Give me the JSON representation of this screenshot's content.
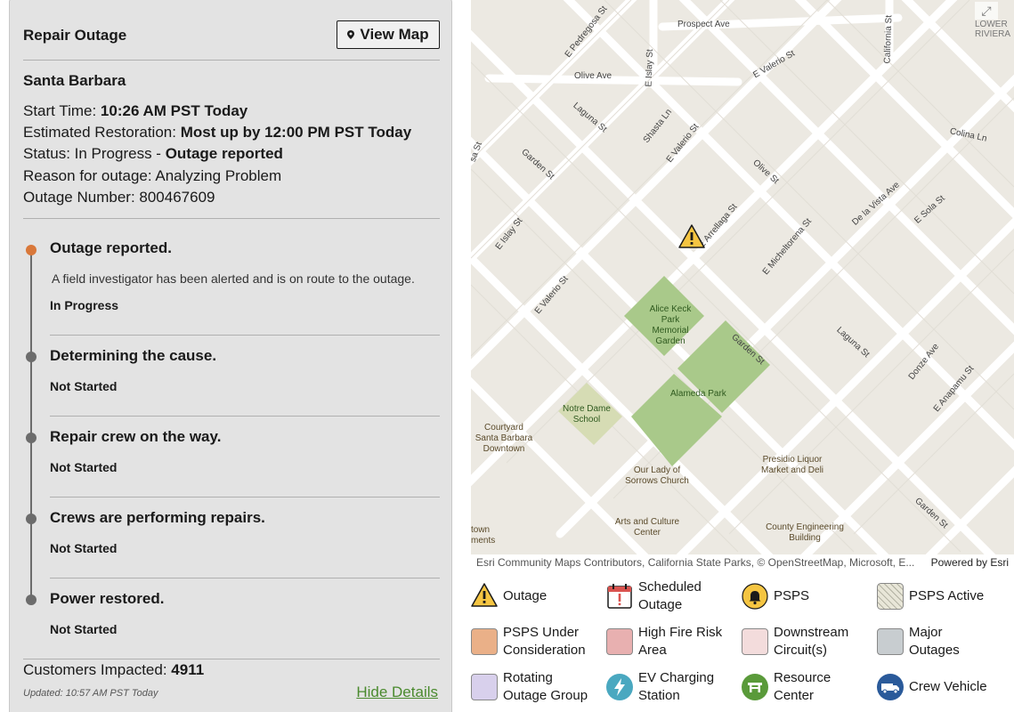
{
  "panel": {
    "title": "Repair Outage",
    "view_map_label": "View Map",
    "city": "Santa Barbara",
    "start_time_label": "Start Time: ",
    "start_time_value": "10:26 AM PST Today",
    "restoration_label": "Estimated Restoration: ",
    "restoration_value": "Most up by 12:00 PM PST Today",
    "status_label": "Status: In Progress - ",
    "status_value": "Outage reported",
    "reason": "Reason for outage: Analyzing Problem",
    "outage_number": "Outage Number: 800467609",
    "steps": [
      {
        "title": "Outage reported.",
        "desc": "A field investigator has been alerted and is on route to the outage.",
        "status": "In Progress"
      },
      {
        "title": "Determining the cause.",
        "status": "Not Started"
      },
      {
        "title": "Repair crew on the way.",
        "status": "Not Started"
      },
      {
        "title": "Crews are performing repairs.",
        "status": "Not Started"
      },
      {
        "title": "Power restored.",
        "status": "Not Started"
      }
    ],
    "customers_label": "Customers Impacted: ",
    "customers_value": "4911",
    "updated": "Updated: 10:57 AM PST Today",
    "hide_details": "Hide Details"
  },
  "map": {
    "streets": [
      "E Pedregosa St",
      "Prospect Ave",
      "California St",
      "E Islay St",
      "Olive Ave",
      "E Valerio St",
      "Laguna St",
      "Shasta Ln",
      "E Valerio St",
      "Colina Ln",
      "Garden St",
      "Olive St",
      "De la Vista Ave",
      "E Sola St",
      "sa St",
      "E Islay St",
      "E Arrellaga St",
      "E Micheltorena St",
      "E Valerio St",
      "Garden St",
      "Laguna St",
      "Donze Ave",
      "E Anapamu St",
      "Garden St"
    ],
    "area_label": "LOWER RIVIERA",
    "parks": [
      "Alice Keck Park Memorial Garden",
      "Alameda Park",
      "Notre Dame School"
    ],
    "pois": [
      "Courtyard Santa Barbara Downtown",
      "Our Lady of Sorrows Church",
      "Presidio Liquor Market and Deli",
      "Arts and Culture Center",
      "County Engineering Building",
      "town ments"
    ],
    "attribution": "Esri Community Maps Contributors, California State Parks, © OpenStreetMap, Microsoft, E...",
    "powered_by": "Powered by Esri"
  },
  "legend": [
    {
      "label": "Outage",
      "icon": "warning-triangle-icon"
    },
    {
      "label": "Scheduled Outage",
      "icon": "calendar-alert-icon"
    },
    {
      "label": "PSPS",
      "icon": "bell-icon"
    },
    {
      "label": "PSPS Active",
      "icon": "hatched-swatch"
    },
    {
      "label": "PSPS Under Consideration",
      "icon": "swatch",
      "color": "#eab088"
    },
    {
      "label": "High Fire Risk Area",
      "icon": "swatch",
      "color": "#e8b0b0"
    },
    {
      "label": "Downstream Circuit(s)",
      "icon": "swatch",
      "color": "#f3dcdc"
    },
    {
      "label": "Major Outages",
      "icon": "swatch",
      "color": "#c8cdd0"
    },
    {
      "label": "Rotating Outage Group",
      "icon": "swatch",
      "color": "#d8d0ec"
    },
    {
      "label": "EV Charging Station",
      "icon": "ev-charging-icon",
      "color": "#4aa8c0"
    },
    {
      "label": "Resource Center",
      "icon": "resource-center-icon",
      "color": "#5a9a3a"
    },
    {
      "label": "Crew Vehicle",
      "icon": "crew-vehicle-icon",
      "color": "#2a5a9a"
    }
  ]
}
